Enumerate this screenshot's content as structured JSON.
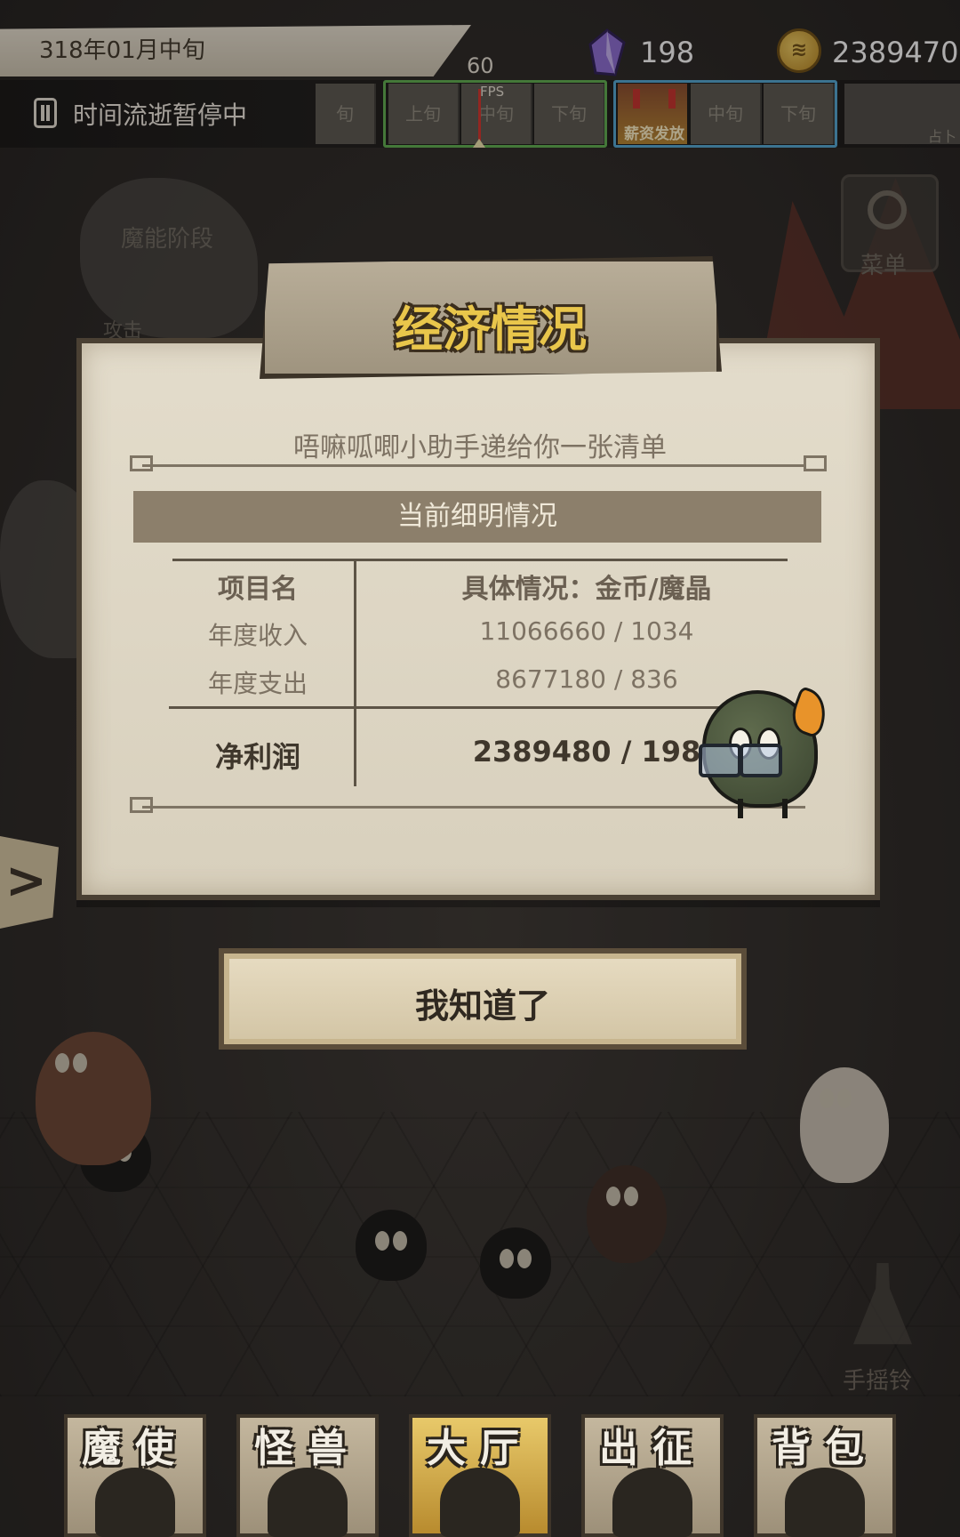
{
  "hud": {
    "date": "318年01月中旬",
    "paused_text": "时间流逝暂停中",
    "fps_value": "60",
    "fps_label": "FPS",
    "crystals": "198",
    "gold": "2389470",
    "timeline": [
      "旬",
      "上旬",
      "中旬",
      "下旬",
      "薪资发放",
      "中旬",
      "下旬"
    ],
    "portrait_label": "占卜",
    "coin_glyph": "≋"
  },
  "side_menu": {
    "menu_label": "菜单",
    "bell_label": "手摇铃",
    "expand_arrow": ">"
  },
  "background_labels": {
    "stage": "魔能阶段",
    "attack": "攻击"
  },
  "dialog": {
    "title": "经济情况",
    "subtitle": "唔嘛呱唧小助手递给你一张清单",
    "section_title": "当前细明情况",
    "table": {
      "header_name": "项目名",
      "header_detail": "具体情况：金币/魔晶",
      "rows": [
        {
          "name": "年度收入",
          "value": "11066660 / 1034"
        },
        {
          "name": "年度支出",
          "value": "8677180 / 836"
        }
      ],
      "total": {
        "name": "净利润",
        "value": "2389480 / 198"
      }
    },
    "confirm_label": "我知道了"
  },
  "bottom_nav": [
    {
      "label": "魔使",
      "active": false
    },
    {
      "label": "怪兽",
      "active": false
    },
    {
      "label": "大厅",
      "active": true
    },
    {
      "label": "出征",
      "active": false
    },
    {
      "label": "背包",
      "active": false
    }
  ],
  "colors": {
    "title_gold": "#e9c64b",
    "parchment": "#e3dccb",
    "needle_red": "#d8322a",
    "box_green": "#5fb04f",
    "box_blue": "#52a8d4"
  }
}
